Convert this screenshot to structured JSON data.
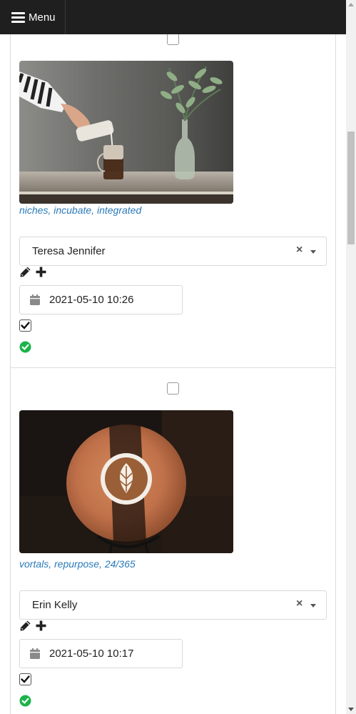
{
  "header": {
    "menu_label": "Menu",
    "menu_icon": "hamburger-icon"
  },
  "colors": {
    "navbar_bg": "#1f1f1f",
    "tag_link": "#2a7ab8",
    "status_ok": "#1bb34a"
  },
  "items": [
    {
      "tags": "niches, incubate, integrated",
      "assignee": "Teresa Jennifer",
      "clear_symbol": "×",
      "datetime": "2021-05-10 10:26",
      "checked": true,
      "status_icon": "check-circle-icon"
    },
    {
      "tags": "vortals, repurpose, 24/365",
      "assignee": "Erin Kelly",
      "clear_symbol": "×",
      "datetime": "2021-05-10 10:17",
      "checked": true,
      "status_icon": "check-circle-icon"
    }
  ]
}
